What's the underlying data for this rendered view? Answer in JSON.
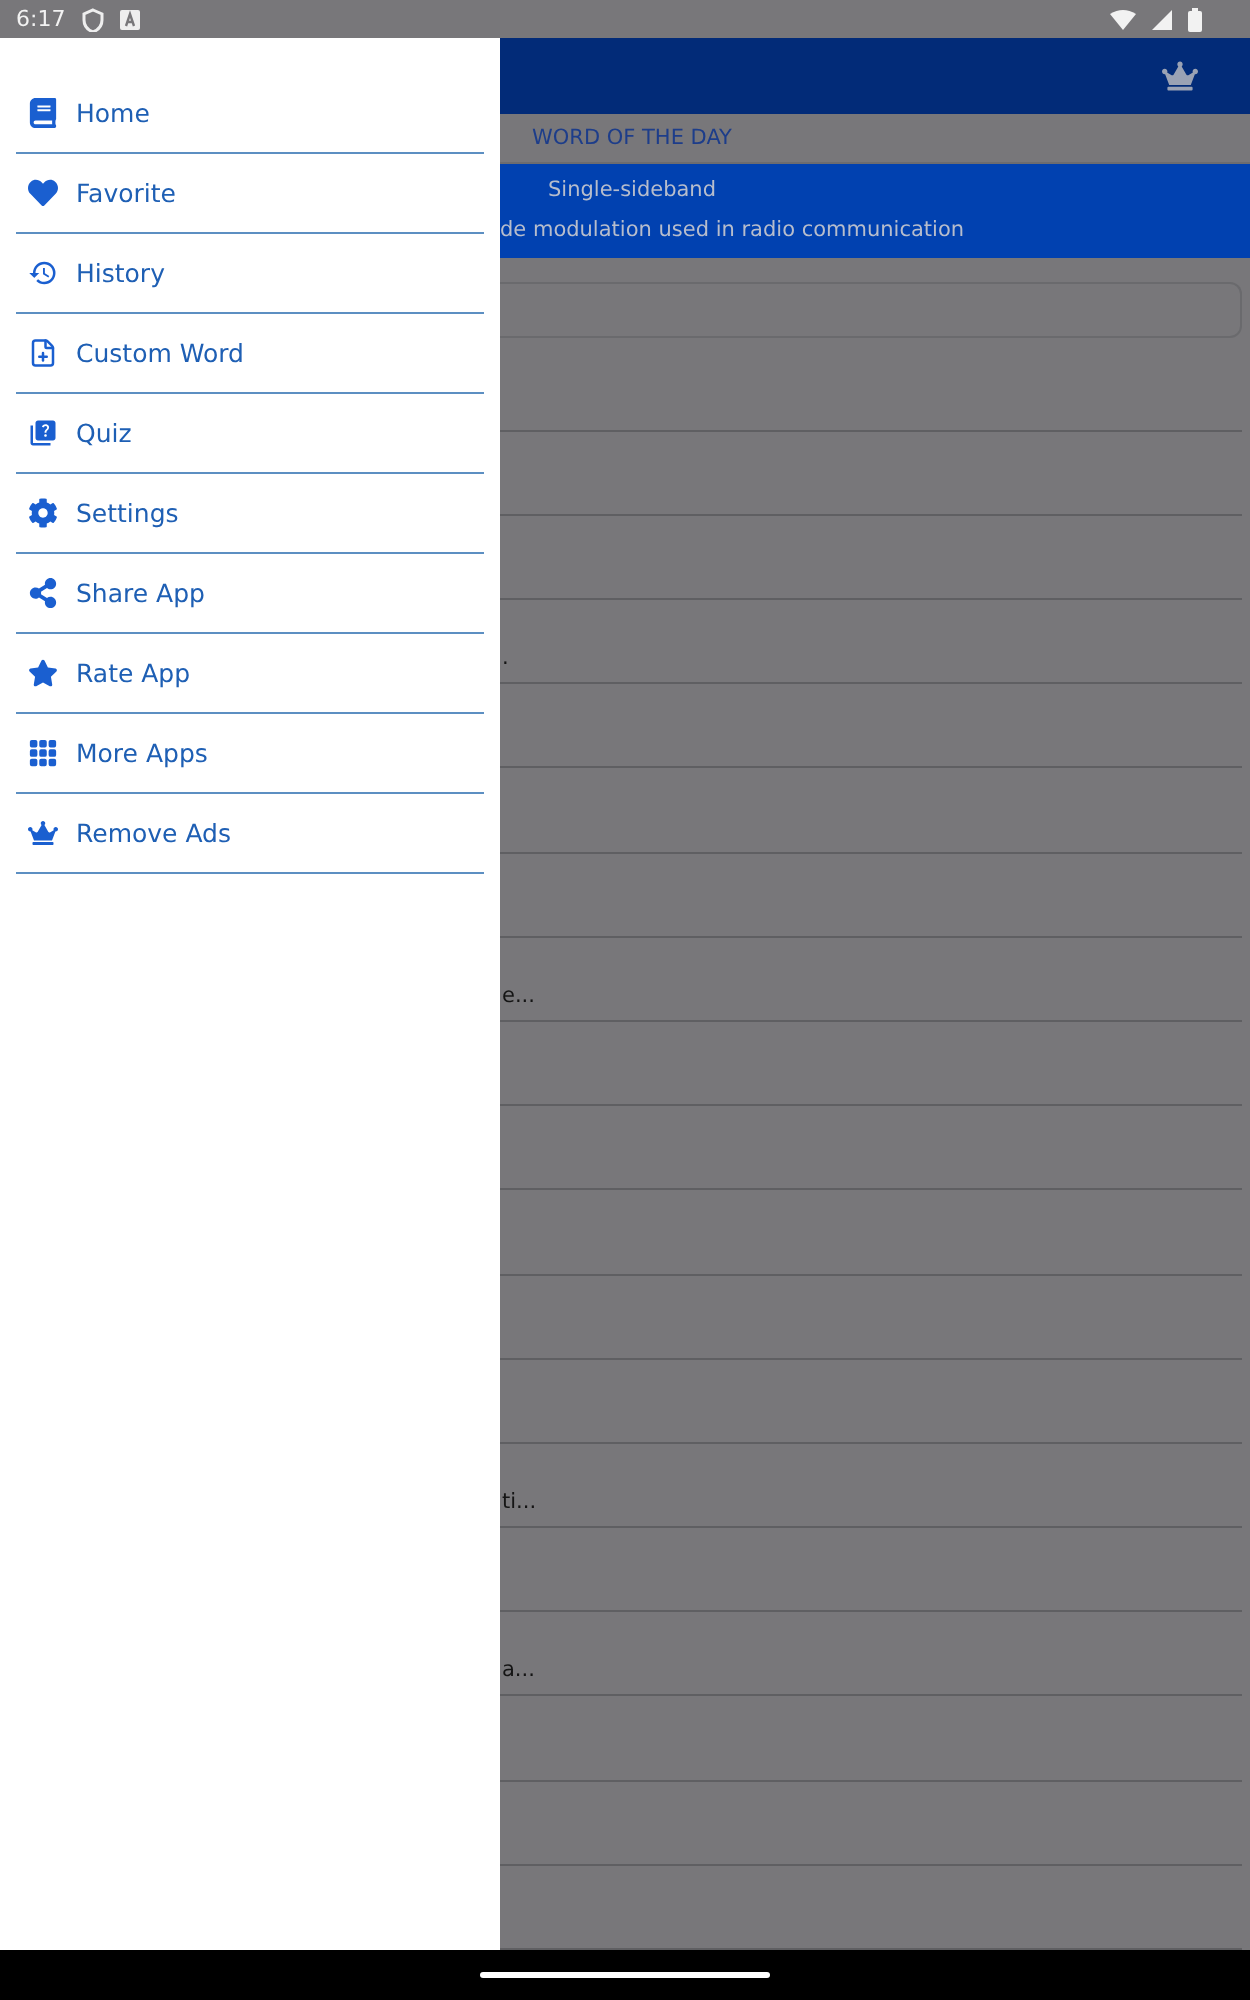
{
  "status_bar": {
    "time": "6:17"
  },
  "drawer": {
    "items": [
      {
        "label": "Home"
      },
      {
        "label": "Favorite"
      },
      {
        "label": "History"
      },
      {
        "label": "Custom Word"
      },
      {
        "label": "Quiz"
      },
      {
        "label": "Settings"
      },
      {
        "label": "Share App"
      },
      {
        "label": "Rate App"
      },
      {
        "label": "More Apps"
      },
      {
        "label": "Remove Ads"
      }
    ]
  },
  "word_of_the_day": {
    "heading": "WORD OF THE DAY",
    "word": "Single-sideband",
    "definition": "de modulation used in radio communication"
  },
  "list": {
    "rows": [
      {},
      {},
      {},
      {
        "text": "."
      },
      {},
      {},
      {},
      {
        "text": "e..."
      },
      {},
      {},
      {},
      {},
      {},
      {
        "text": "ti..."
      },
      {},
      {
        "text": "a..."
      },
      {},
      {},
      {}
    ]
  }
}
